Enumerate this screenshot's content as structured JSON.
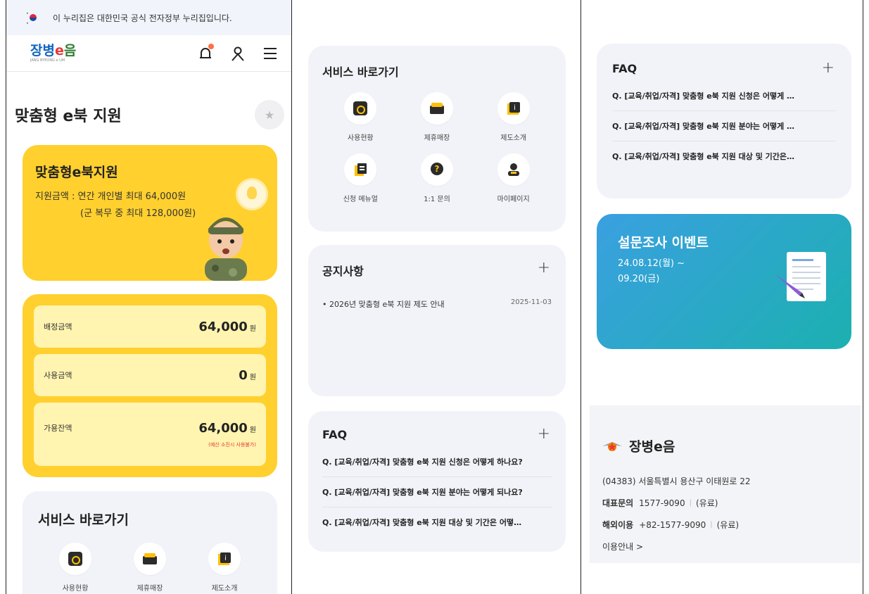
{
  "gov_banner": {
    "text": "이 누리집은 대한민국 공식 전자정부 누리집입니다."
  },
  "header": {
    "logo_main_1": "장병",
    "logo_main_2": "e",
    "logo_main_3": "음",
    "logo_sub": "JANG BYEONG e UM"
  },
  "page": {
    "title": "맞춤형 e북 지원"
  },
  "hero": {
    "title": "맞춤형e북지원",
    "line1": "지원금액 : 연간 개인별 최대 64,000원",
    "line2": "(군 복무 중 최대 128,000원)"
  },
  "amounts": {
    "rows": [
      {
        "label": "배정금액",
        "value": "64,000",
        "unit": "원"
      },
      {
        "label": "사용금액",
        "value": "0",
        "unit": "원"
      },
      {
        "label": "가용잔액",
        "value": "64,000",
        "unit": "원",
        "note": "(예산 소진시 사용불가)"
      }
    ]
  },
  "services": {
    "title": "서비스 바로가기",
    "items": [
      {
        "label": "사용현황",
        "icon": "search-doc-icon"
      },
      {
        "label": "제휴매장",
        "icon": "store-icon"
      },
      {
        "label": "제도소개",
        "icon": "info-book-icon"
      },
      {
        "label": "신청 메뉴얼",
        "icon": "manual-icon"
      },
      {
        "label": "1:1 문의",
        "icon": "question-icon"
      },
      {
        "label": "마이페이지",
        "icon": "user-icon"
      }
    ]
  },
  "notice": {
    "title": "공지사항",
    "plus": "+",
    "items": [
      {
        "title": "2026년 맞춤형 e북 지원 제도 안내",
        "date": "2025-11-03"
      }
    ]
  },
  "faq": {
    "title": "FAQ",
    "plus": "+",
    "items": [
      "Q. [교육/취업/자격] 맞춤형 e북 지원 신청은 어떻게 하나요?",
      "Q. [교육/취업/자격] 맞춤형 e북 지원 분야는 어떻게 되나요?",
      "Q. [교육/취업/자격] 맞춤형 e북 지원 대상 및 기간은 어떻…"
    ],
    "items_short": [
      "Q. [교육/취업/자격] 맞춤형 e북 지원 신청은 어떻게 …",
      "Q. [교육/취업/자격] 맞춤형 e북 지원 분야는 어떻게 …",
      "Q. [교육/취업/자격] 맞춤형 e북 지원 대상 및 기간은…"
    ]
  },
  "event": {
    "title": "설문조사 이벤트",
    "date": "24.08.12(월) ~ 09.20(금)"
  },
  "footer": {
    "logo": "장병e음",
    "address": "(04383) 서울특별시 용산구 이태원로 22",
    "phone_label": "대표문의",
    "phone": "1577-9090",
    "phone_fee": "(유료)",
    "overseas_label": "해외이용",
    "overseas": "+82-1577-9090",
    "overseas_fee": "(유료)",
    "guide": "이용안내 >"
  },
  "colors": {
    "yellow": "#ffd02e",
    "light_yellow": "#fff4b0",
    "card_bg": "#f2f3f8",
    "event_start": "#3aa0e0",
    "event_end": "#1cb0b0",
    "note_red": "#e53935"
  }
}
